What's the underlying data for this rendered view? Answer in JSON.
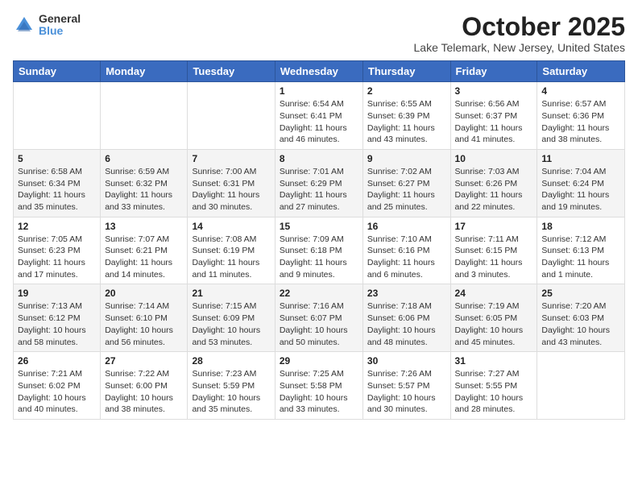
{
  "logo": {
    "general": "General",
    "blue": "Blue"
  },
  "title": "October 2025",
  "location": "Lake Telemark, New Jersey, United States",
  "days": [
    "Sunday",
    "Monday",
    "Tuesday",
    "Wednesday",
    "Thursday",
    "Friday",
    "Saturday"
  ],
  "weeks": [
    [
      {
        "day": "",
        "content": ""
      },
      {
        "day": "",
        "content": ""
      },
      {
        "day": "",
        "content": ""
      },
      {
        "day": "1",
        "content": "Sunrise: 6:54 AM\nSunset: 6:41 PM\nDaylight: 11 hours and 46 minutes."
      },
      {
        "day": "2",
        "content": "Sunrise: 6:55 AM\nSunset: 6:39 PM\nDaylight: 11 hours and 43 minutes."
      },
      {
        "day": "3",
        "content": "Sunrise: 6:56 AM\nSunset: 6:37 PM\nDaylight: 11 hours and 41 minutes."
      },
      {
        "day": "4",
        "content": "Sunrise: 6:57 AM\nSunset: 6:36 PM\nDaylight: 11 hours and 38 minutes."
      }
    ],
    [
      {
        "day": "5",
        "content": "Sunrise: 6:58 AM\nSunset: 6:34 PM\nDaylight: 11 hours and 35 minutes."
      },
      {
        "day": "6",
        "content": "Sunrise: 6:59 AM\nSunset: 6:32 PM\nDaylight: 11 hours and 33 minutes."
      },
      {
        "day": "7",
        "content": "Sunrise: 7:00 AM\nSunset: 6:31 PM\nDaylight: 11 hours and 30 minutes."
      },
      {
        "day": "8",
        "content": "Sunrise: 7:01 AM\nSunset: 6:29 PM\nDaylight: 11 hours and 27 minutes."
      },
      {
        "day": "9",
        "content": "Sunrise: 7:02 AM\nSunset: 6:27 PM\nDaylight: 11 hours and 25 minutes."
      },
      {
        "day": "10",
        "content": "Sunrise: 7:03 AM\nSunset: 6:26 PM\nDaylight: 11 hours and 22 minutes."
      },
      {
        "day": "11",
        "content": "Sunrise: 7:04 AM\nSunset: 6:24 PM\nDaylight: 11 hours and 19 minutes."
      }
    ],
    [
      {
        "day": "12",
        "content": "Sunrise: 7:05 AM\nSunset: 6:23 PM\nDaylight: 11 hours and 17 minutes."
      },
      {
        "day": "13",
        "content": "Sunrise: 7:07 AM\nSunset: 6:21 PM\nDaylight: 11 hours and 14 minutes."
      },
      {
        "day": "14",
        "content": "Sunrise: 7:08 AM\nSunset: 6:19 PM\nDaylight: 11 hours and 11 minutes."
      },
      {
        "day": "15",
        "content": "Sunrise: 7:09 AM\nSunset: 6:18 PM\nDaylight: 11 hours and 9 minutes."
      },
      {
        "day": "16",
        "content": "Sunrise: 7:10 AM\nSunset: 6:16 PM\nDaylight: 11 hours and 6 minutes."
      },
      {
        "day": "17",
        "content": "Sunrise: 7:11 AM\nSunset: 6:15 PM\nDaylight: 11 hours and 3 minutes."
      },
      {
        "day": "18",
        "content": "Sunrise: 7:12 AM\nSunset: 6:13 PM\nDaylight: 11 hours and 1 minute."
      }
    ],
    [
      {
        "day": "19",
        "content": "Sunrise: 7:13 AM\nSunset: 6:12 PM\nDaylight: 10 hours and 58 minutes."
      },
      {
        "day": "20",
        "content": "Sunrise: 7:14 AM\nSunset: 6:10 PM\nDaylight: 10 hours and 56 minutes."
      },
      {
        "day": "21",
        "content": "Sunrise: 7:15 AM\nSunset: 6:09 PM\nDaylight: 10 hours and 53 minutes."
      },
      {
        "day": "22",
        "content": "Sunrise: 7:16 AM\nSunset: 6:07 PM\nDaylight: 10 hours and 50 minutes."
      },
      {
        "day": "23",
        "content": "Sunrise: 7:18 AM\nSunset: 6:06 PM\nDaylight: 10 hours and 48 minutes."
      },
      {
        "day": "24",
        "content": "Sunrise: 7:19 AM\nSunset: 6:05 PM\nDaylight: 10 hours and 45 minutes."
      },
      {
        "day": "25",
        "content": "Sunrise: 7:20 AM\nSunset: 6:03 PM\nDaylight: 10 hours and 43 minutes."
      }
    ],
    [
      {
        "day": "26",
        "content": "Sunrise: 7:21 AM\nSunset: 6:02 PM\nDaylight: 10 hours and 40 minutes."
      },
      {
        "day": "27",
        "content": "Sunrise: 7:22 AM\nSunset: 6:00 PM\nDaylight: 10 hours and 38 minutes."
      },
      {
        "day": "28",
        "content": "Sunrise: 7:23 AM\nSunset: 5:59 PM\nDaylight: 10 hours and 35 minutes."
      },
      {
        "day": "29",
        "content": "Sunrise: 7:25 AM\nSunset: 5:58 PM\nDaylight: 10 hours and 33 minutes."
      },
      {
        "day": "30",
        "content": "Sunrise: 7:26 AM\nSunset: 5:57 PM\nDaylight: 10 hours and 30 minutes."
      },
      {
        "day": "31",
        "content": "Sunrise: 7:27 AM\nSunset: 5:55 PM\nDaylight: 10 hours and 28 minutes."
      },
      {
        "day": "",
        "content": ""
      }
    ]
  ]
}
